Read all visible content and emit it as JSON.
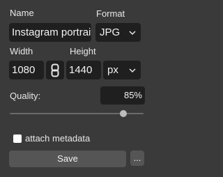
{
  "export": {
    "name_label": "Name",
    "name_value": "Instagram portrait",
    "format_label": "Format",
    "format_value": "JPG",
    "width_label": "Width",
    "width_value": "1080",
    "height_label": "Height",
    "height_value": "1440",
    "unit_value": "px",
    "quality_label": "Quality:",
    "quality_value": "85%",
    "quality_level": 0.85,
    "metadata_label": "attach metadata",
    "save_label": "Save",
    "more_label": "...",
    "link_icon": "chain-link-icon",
    "dropdown_icon": "chevron-down-icon"
  },
  "colors": {
    "panel_bg": "#3a3a3a",
    "field_bg": "#1f1f1f",
    "button_bg": "#555555",
    "text": "#e6e6e6"
  }
}
